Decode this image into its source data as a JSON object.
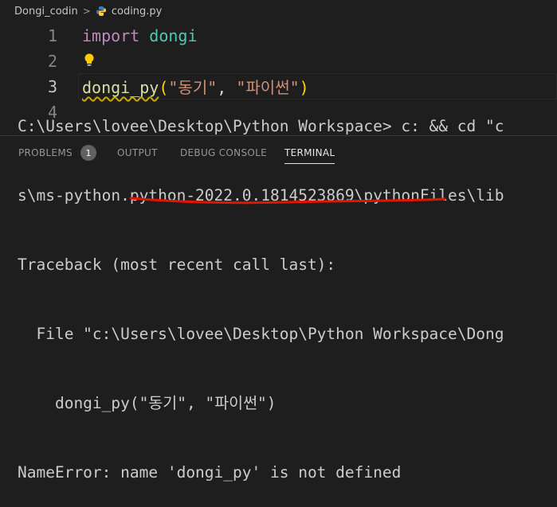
{
  "breadcrumb": {
    "folder": "Dongi_codin",
    "separator": ">",
    "file": "coding.py",
    "file_icon": "python-icon"
  },
  "editor": {
    "lines": [
      {
        "number": "1",
        "import_kw": "import",
        "module": "dongi"
      },
      {
        "number": "2"
      },
      {
        "number": "3",
        "func": "dongi_py",
        "open": "(",
        "arg1": "\"동기\"",
        "comma": ", ",
        "arg2": "\"파이썬\"",
        "close": ")"
      },
      {
        "number": "4"
      }
    ]
  },
  "panel": {
    "tabs": [
      {
        "label": "PROBLEMS",
        "badge": "1"
      },
      {
        "label": "OUTPUT"
      },
      {
        "label": "DEBUG CONSOLE"
      },
      {
        "label": "TERMINAL",
        "active": true
      }
    ]
  },
  "terminal": {
    "lines": [
      "C:\\Users\\lovee\\Desktop\\Python Workspace> c: && cd \"c",
      "s\\ms-python.python-2022.0.1814523869\\pythonFiles\\lib",
      "Traceback (most recent call last):",
      "  File \"c:\\Users\\lovee\\Desktop\\Python Workspace\\Dong",
      "    dongi_py(\"동기\", \"파이썬\")",
      "NameError: name 'dongi_py' is not defined"
    ]
  },
  "colors": {
    "background": "#1e1e1e",
    "keyword": "#c586c0",
    "module": "#4ec9b0",
    "function": "#dcdcaa",
    "string": "#ce9178",
    "annotation_underline": "#e51400"
  }
}
